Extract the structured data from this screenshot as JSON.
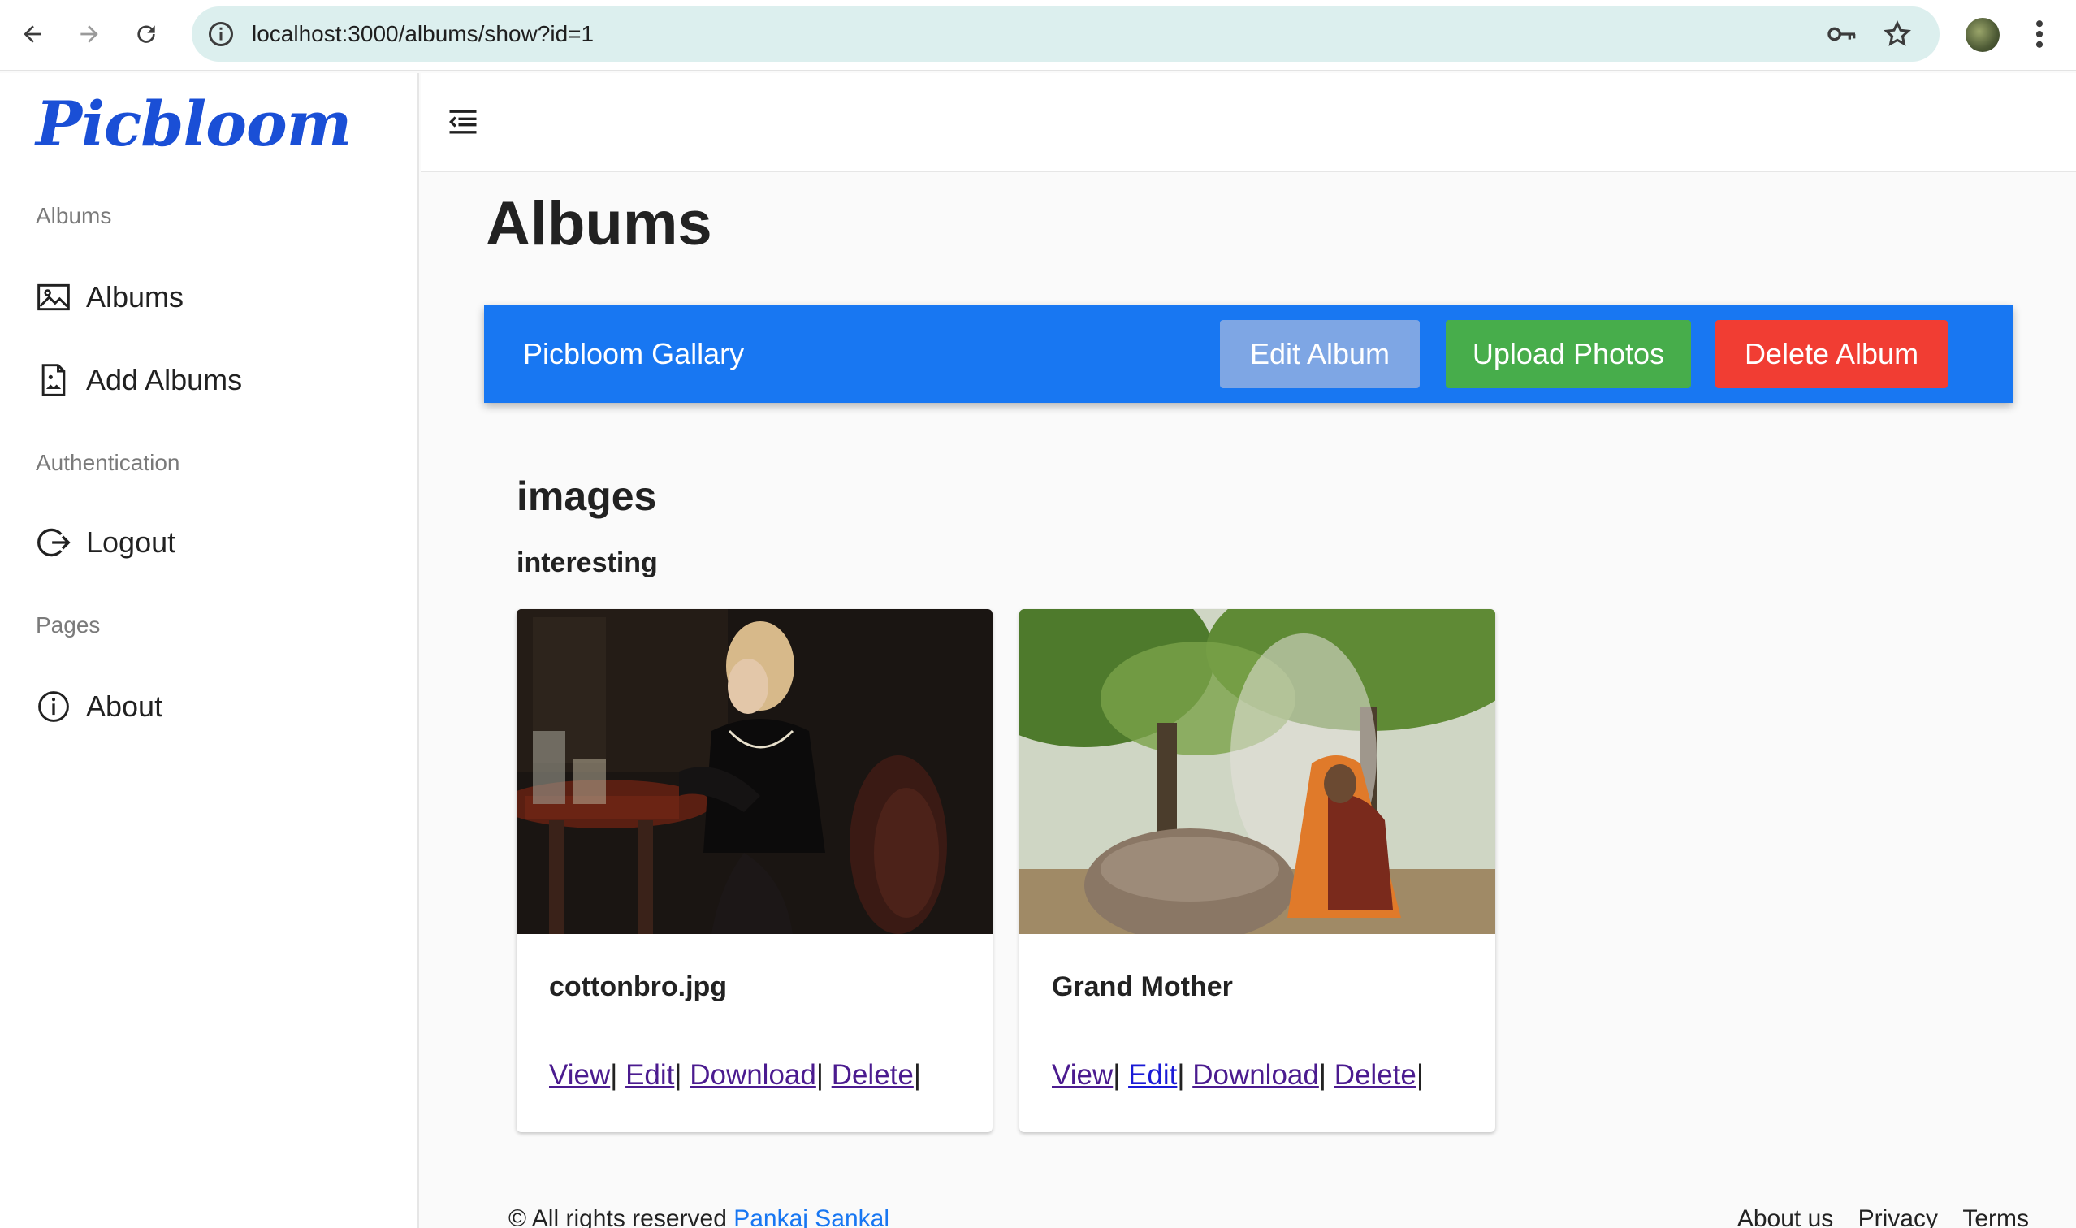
{
  "browser": {
    "url_host": "localhost",
    "url_path": ":3000/albums/show?id=1"
  },
  "sidebar": {
    "brand": "Picbloom",
    "sections": [
      {
        "label": "Albums"
      },
      {
        "label": "Authentication"
      },
      {
        "label": "Pages"
      }
    ],
    "items": [
      {
        "label": "Albums",
        "icon": "image-icon"
      },
      {
        "label": "Add Albums",
        "icon": "file-image-icon"
      },
      {
        "label": "Logout",
        "icon": "logout-icon"
      },
      {
        "label": "About",
        "icon": "info-icon"
      }
    ]
  },
  "main": {
    "title": "Albums",
    "album_bar": {
      "name": "Picbloom Gallary",
      "edit_label": "Edit Album",
      "upload_label": "Upload Photos",
      "delete_label": "Delete Album",
      "colors": {
        "bar": "#1877f2",
        "edit": "#7ea6e4",
        "upload": "#47ad4b",
        "delete": "#f13d33"
      }
    },
    "images_heading": "images",
    "album_description": "interesting",
    "cards": [
      {
        "caption": "cottonbro.jpg",
        "links": {
          "view": "View",
          "edit": "Edit",
          "download": "Download",
          "delete": "Delete"
        }
      },
      {
        "caption": "Grand Mother",
        "links": {
          "view": "View",
          "edit": "Edit",
          "download": "Download",
          "delete": "Delete"
        }
      }
    ],
    "separator": "|"
  },
  "footer": {
    "copyright": "© All rights reserved",
    "author": "Pankaj Sankal",
    "links": [
      "About us",
      "Privacy",
      "Terms"
    ]
  }
}
